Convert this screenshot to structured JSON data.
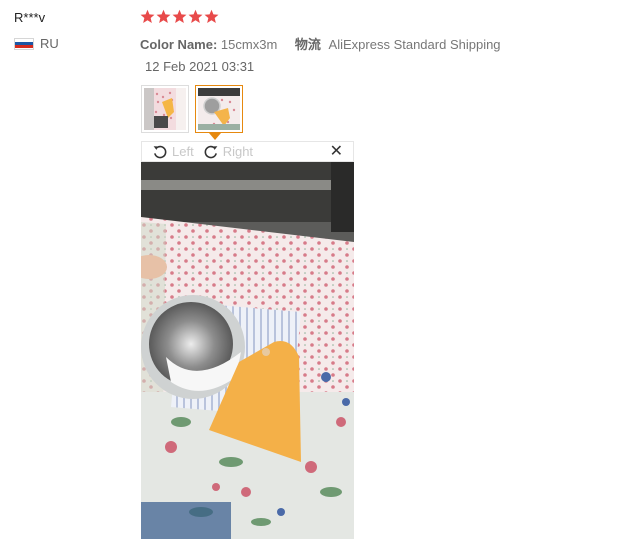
{
  "review": {
    "user": {
      "name": "R***v",
      "country_code": "RU",
      "flag_colors": [
        "#ffffff",
        "#1c57a5",
        "#d52b1e"
      ]
    },
    "rating": 5,
    "star_color": "#e84a4a",
    "attributes": {
      "color_label": "Color Name:",
      "color_value": "15cmx3m",
      "shipping_label": "物流",
      "shipping_value": "AliExpress Standard Shipping"
    },
    "date": "12 Feb 2021 03:31",
    "thumbnails": [
      {
        "name": "review-photo-1",
        "selected": false
      },
      {
        "name": "review-photo-2",
        "selected": true
      }
    ],
    "accent_color": "#e6890f"
  },
  "viewer": {
    "rotate_left_label": "Left",
    "rotate_right_label": "Right",
    "close_glyph": "✕",
    "icons": [
      "rotate-left-icon",
      "rotate-right-icon",
      "close-icon"
    ]
  }
}
